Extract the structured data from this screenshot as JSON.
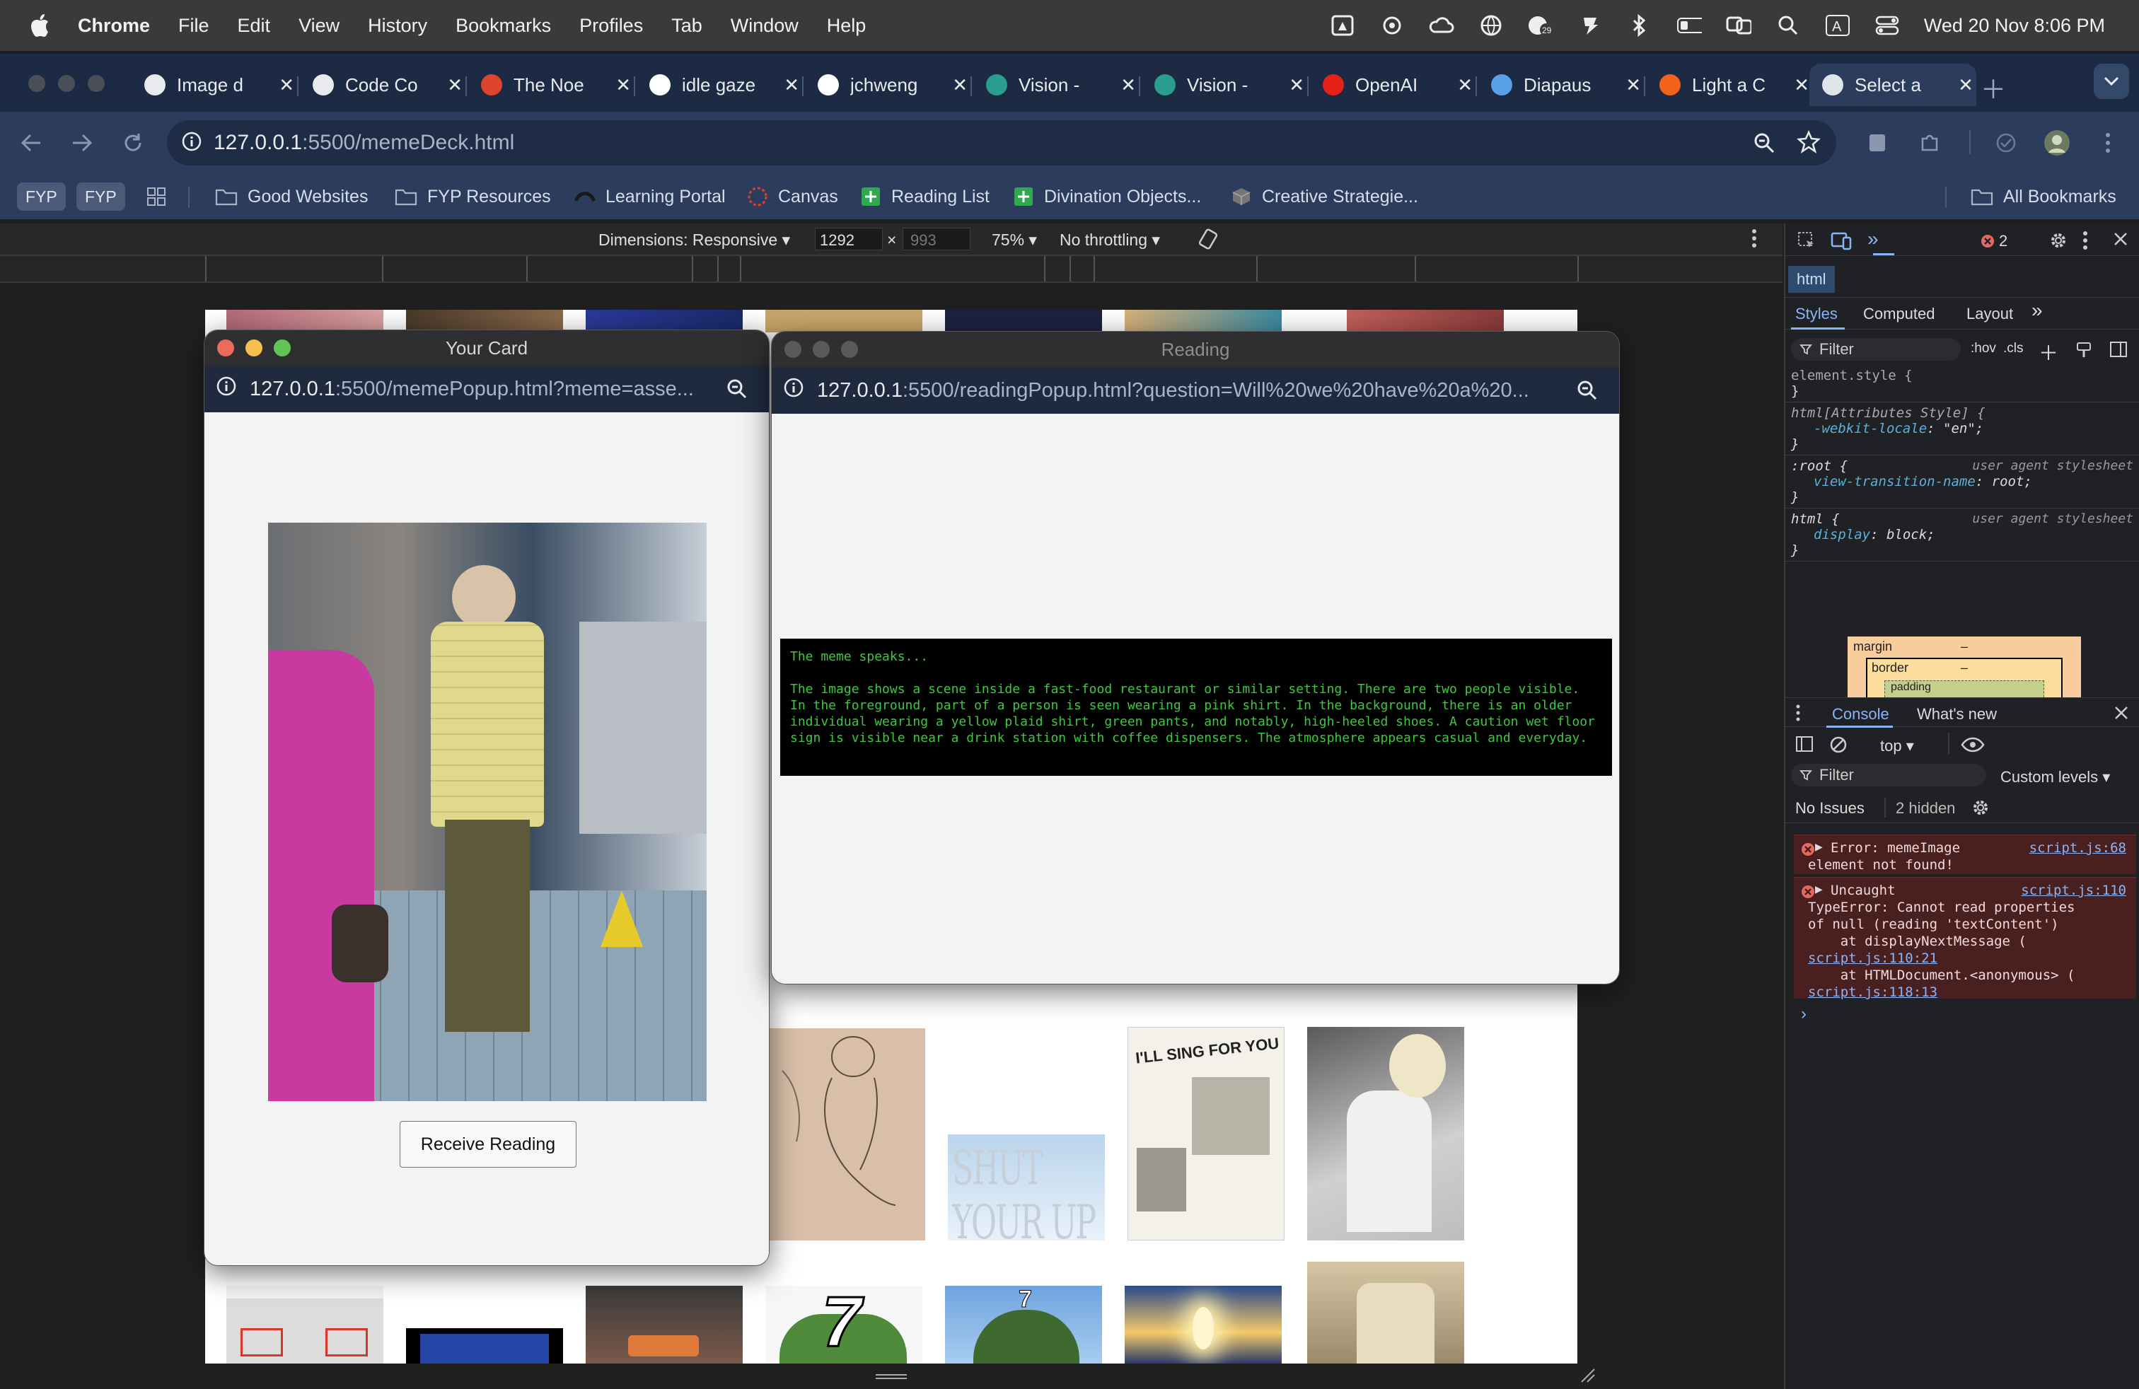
{
  "menubar": {
    "app": "Chrome",
    "items": [
      "File",
      "Edit",
      "View",
      "History",
      "Bookmarks",
      "Profiles",
      "Tab",
      "Window",
      "Help"
    ],
    "datetime": "Wed 20 Nov  8:06 PM"
  },
  "tabs": [
    {
      "title": "Image d",
      "color": "#e8eaed"
    },
    {
      "title": "Code Co",
      "color": "#e8eaed"
    },
    {
      "title": "The Noe",
      "color": "#e0442c"
    },
    {
      "title": "idle gaze",
      "color": "#ffffff"
    },
    {
      "title": "jchweng",
      "color": "#ffffff"
    },
    {
      "title": "Vision -",
      "color": "#2a9d8f"
    },
    {
      "title": "Vision -",
      "color": "#2a9d8f"
    },
    {
      "title": "OpenAI",
      "color": "#e62117"
    },
    {
      "title": "Diapaus",
      "color": "#5aa0e6"
    },
    {
      "title": "Light a C",
      "color": "#f2621b"
    },
    {
      "title": "Select a",
      "color": "#dfe3ea"
    }
  ],
  "address": {
    "host": "127.0.0.1",
    "path": ":5500/memeDeck.html"
  },
  "bookmarks": {
    "chips": [
      "FYP",
      "FYP"
    ],
    "items": [
      "Good Websites",
      "FYP Resources",
      "Learning Portal",
      "Canvas",
      "Reading List",
      "Divination Objects...",
      "Creative Strategie..."
    ],
    "all": "All Bookmarks"
  },
  "device_toolbar": {
    "dimensions": "Dimensions: Responsive",
    "width": "1292",
    "times": "×",
    "height": "993",
    "zoom": "75%",
    "throttle": "No throttling"
  },
  "card_popup": {
    "title": "Your Card",
    "url_host": "127.0.0.1",
    "url_path": ":5500/memePopup.html?meme=asse...",
    "button": "Receive Reading"
  },
  "reading_popup": {
    "title": "Reading",
    "url_host": "127.0.0.1",
    "url_path": ":5500/readingPopup.html?question=Will%20we%20have%20a%20...",
    "heading": "The meme speaks...",
    "text": "The image shows a scene inside a fast-food restaurant or similar setting. There are two people visible. In the foreground, part of a person is seen wearing a pink shirt. In the background, there is an older individual wearing a yellow plaid shirt, green pants, and notably, high-heeled shoes. A caution wet floor sign is visible near a drink station with coffee dispensers. The atmosphere appears casual and everyday."
  },
  "page_thumbs": {
    "shut_your_up": "SHUT YOUR UP",
    "seven": "7",
    "sing": "I'LL SING FOR YOU"
  },
  "devtools": {
    "error_count": "2",
    "breadcrumb": "html",
    "tabs": [
      "Styles",
      "Computed",
      "Layout"
    ],
    "filter_placeholder": "Filter",
    "hov": ":hov",
    "cls": ".cls",
    "rules": [
      {
        "sel": "element.style {",
        "props": [],
        "src": ""
      },
      {
        "sel": "html[Attributes Style] {",
        "props": [
          [
            "-webkit-locale",
            "\"en\";"
          ]
        ],
        "src": ""
      },
      {
        "sel": ":root {",
        "props": [
          [
            "view-transition-name",
            "root;"
          ]
        ],
        "src": "user agent stylesheet"
      },
      {
        "sel": "html {",
        "props": [
          [
            "display",
            "block;"
          ]
        ],
        "src": "user agent stylesheet"
      }
    ],
    "box": {
      "margin": "margin",
      "border": "border",
      "padding": "padding",
      "dash": "–"
    },
    "console_tabs": [
      "Console",
      "What's new"
    ],
    "context": "top",
    "custom_levels": "Custom levels",
    "no_issues": "No Issues",
    "hidden": "2 hidden",
    "errors": [
      {
        "lines": [
          "Error: memeImage",
          "element not found!"
        ],
        "link": "script.js:68"
      },
      {
        "lines": [
          "Uncaught",
          "TypeError: Cannot read properties",
          "of null (reading 'textContent')",
          "    at displayNextMessage (",
          "    at HTMLDocument.<anonymous> ("
        ],
        "link": "script.js:110",
        "inner_links": [
          "script.js:110:21",
          "script.js:118:13"
        ]
      }
    ]
  }
}
